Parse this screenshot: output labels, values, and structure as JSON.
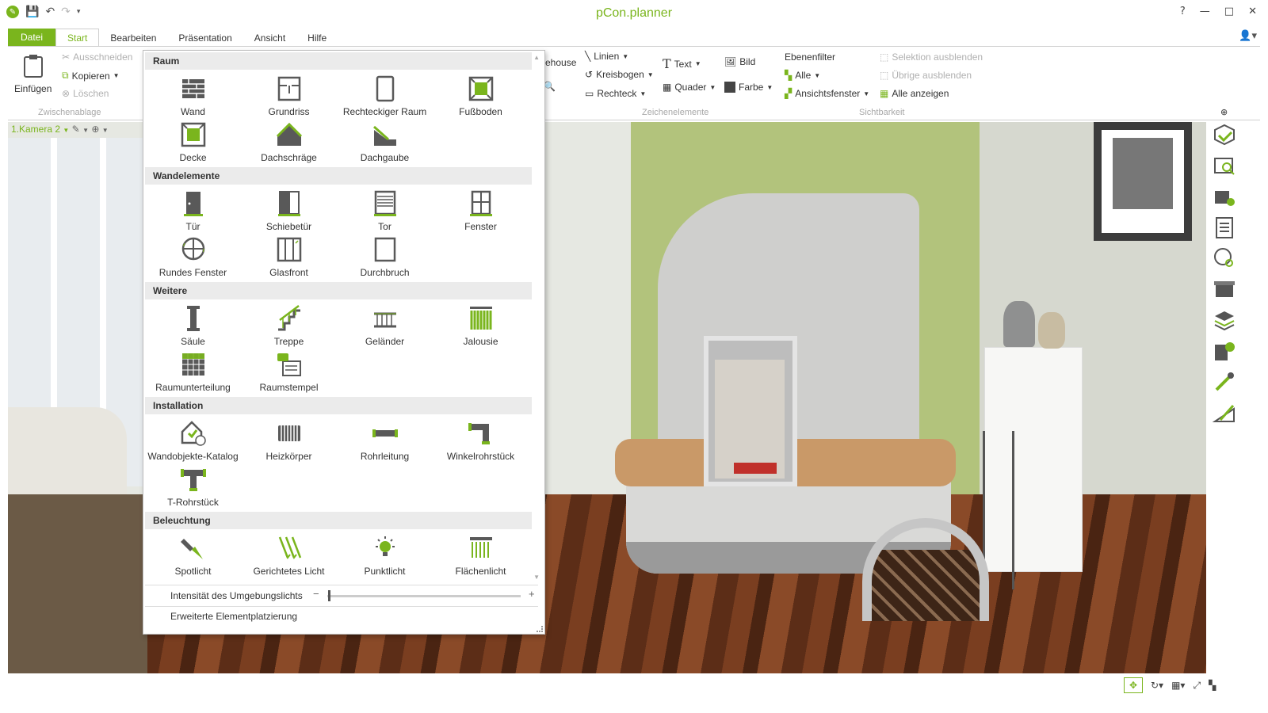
{
  "app": {
    "title": "pCon.planner"
  },
  "window_controls": {
    "help": "?",
    "minimize": "—",
    "maximize": "□",
    "close": "✕"
  },
  "menu": {
    "tabs": [
      "Datei",
      "Start",
      "Bearbeiten",
      "Präsentation",
      "Ansicht",
      "Hilfe"
    ],
    "active": "Start"
  },
  "ribbon": {
    "clipboard": {
      "paste": "Einfügen",
      "cut": "Ausschneiden",
      "copy": "Kopieren",
      "delete": "Löschen",
      "group_label": "Zwischenablage"
    },
    "partial_text": "ehouse",
    "drawing": {
      "lines": "Linien",
      "arc": "Kreisbogen",
      "rect": "Rechteck",
      "text": "Text",
      "cuboid": "Quader",
      "image": "Bild",
      "color": "Farbe",
      "group_label": "Zeichenelemente"
    },
    "visibility": {
      "layer_filter": "Ebenenfilter",
      "all": "Alle",
      "view_window": "Ansichtsfenster",
      "hide_selection": "Selektion ausblenden",
      "hide_others": "Übrige ausblenden",
      "show_all": "Alle anzeigen",
      "group_label": "Sichtbarkeit"
    }
  },
  "viewport": {
    "camera": "1.Kamera 2"
  },
  "panel": {
    "sections": [
      {
        "title": "Raum",
        "items": [
          {
            "label": "Wand",
            "icon": "wall-icon"
          },
          {
            "label": "Grundriss",
            "icon": "floorplan-icon"
          },
          {
            "label": "Rechteckiger Raum",
            "icon": "rect-room-icon"
          },
          {
            "label": "Fußboden",
            "icon": "floor-icon"
          },
          {
            "label": "Decke",
            "icon": "ceiling-icon"
          },
          {
            "label": "Dachschräge",
            "icon": "roof-slope-icon"
          },
          {
            "label": "Dachgaube",
            "icon": "dormer-icon"
          }
        ]
      },
      {
        "title": "Wandelemente",
        "items": [
          {
            "label": "Tür",
            "icon": "door-icon"
          },
          {
            "label": "Schiebetür",
            "icon": "sliding-door-icon"
          },
          {
            "label": "Tor",
            "icon": "gate-icon"
          },
          {
            "label": "Fenster",
            "icon": "window-icon"
          },
          {
            "label": "Rundes Fenster",
            "icon": "round-window-icon"
          },
          {
            "label": "Glasfront",
            "icon": "glass-front-icon"
          },
          {
            "label": "Durchbruch",
            "icon": "opening-icon"
          }
        ]
      },
      {
        "title": "Weitere",
        "items": [
          {
            "label": "Säule",
            "icon": "column-icon"
          },
          {
            "label": "Treppe",
            "icon": "stairs-icon"
          },
          {
            "label": "Geländer",
            "icon": "railing-icon"
          },
          {
            "label": "Jalousie",
            "icon": "blinds-icon"
          },
          {
            "label": "Raumunterteilung",
            "icon": "room-division-icon"
          },
          {
            "label": "Raumstempel",
            "icon": "room-stamp-icon"
          }
        ]
      },
      {
        "title": "Installation",
        "items": [
          {
            "label": "Wandobjekte-Katalog",
            "icon": "wall-catalog-icon"
          },
          {
            "label": "Heizkörper",
            "icon": "radiator-icon"
          },
          {
            "label": "Rohrleitung",
            "icon": "pipe-icon"
          },
          {
            "label": "Winkelrohrstück",
            "icon": "elbow-pipe-icon"
          },
          {
            "label": "T-Rohrstück",
            "icon": "tee-pipe-icon"
          }
        ]
      },
      {
        "title": "Beleuchtung",
        "items": [
          {
            "label": "Spotlicht",
            "icon": "spotlight-icon"
          },
          {
            "label": "Gerichtetes Licht",
            "icon": "directional-light-icon"
          },
          {
            "label": "Punktlicht",
            "icon": "point-light-icon"
          },
          {
            "label": "Flächenlicht",
            "icon": "area-light-icon"
          }
        ]
      }
    ],
    "ambient_light_label": "Intensität des Umgebungslichts",
    "ambient_light_value": 0.0,
    "advanced_placement": "Erweiterte Elementplatzierung"
  },
  "colors": {
    "accent": "#7ab51d",
    "icon_gray": "#595959"
  }
}
